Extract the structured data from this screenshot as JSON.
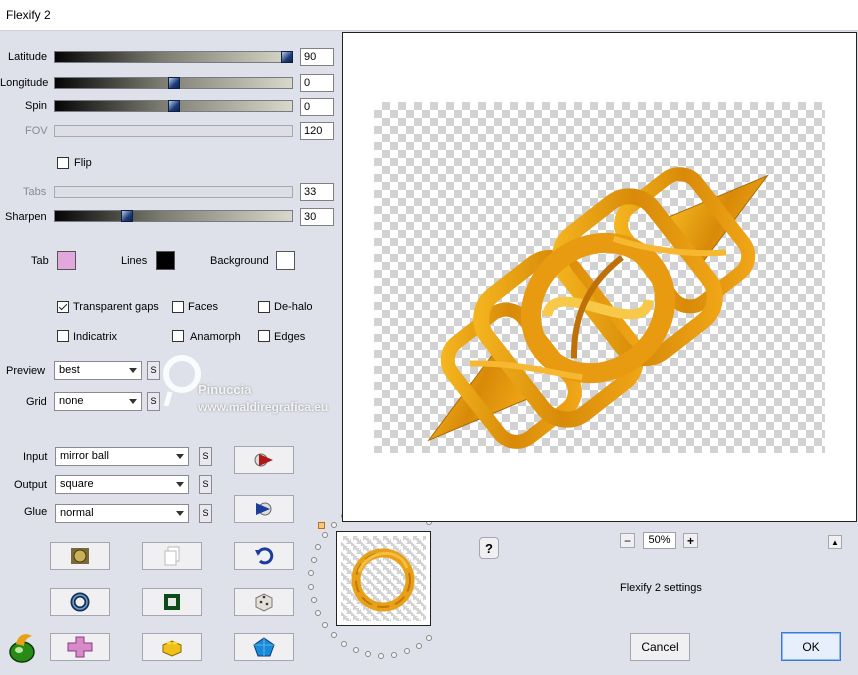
{
  "window": {
    "title": "Flexify 2"
  },
  "sliders": {
    "latitude": {
      "label": "Latitude",
      "value": "90",
      "fraction": 1.0
    },
    "longitude": {
      "label": "Longitude",
      "value": "0",
      "fraction": 0.5
    },
    "spin": {
      "label": "Spin",
      "value": "0",
      "fraction": 0.5
    },
    "fov": {
      "label": "FOV",
      "value": "120"
    },
    "tabs": {
      "label": "Tabs",
      "value": "33"
    },
    "sharpen": {
      "label": "Sharpen",
      "value": "30",
      "fraction": 0.3
    }
  },
  "flip": {
    "label": "Flip",
    "checked": false
  },
  "colors": {
    "tab": {
      "label": "Tab",
      "color": "#e0a8dc"
    },
    "lines": {
      "label": "Lines",
      "color": "#000000"
    },
    "background": {
      "label": "Background",
      "color": "#ffffff"
    }
  },
  "options": {
    "transparent_gaps": {
      "label": "Transparent gaps",
      "checked": true
    },
    "faces": {
      "label": "Faces",
      "checked": false
    },
    "de_halo": {
      "label": "De-halo",
      "checked": false
    },
    "indicatrix": {
      "label": "Indicatrix",
      "checked": false
    },
    "anamorph": {
      "label": "Anamorph",
      "checked": false
    },
    "edges": {
      "label": "Edges",
      "checked": false
    }
  },
  "selects": {
    "preview": {
      "label": "Preview",
      "value": "best"
    },
    "grid": {
      "label": "Grid",
      "value": "none"
    },
    "input": {
      "label": "Input",
      "value": "mirror ball"
    },
    "output": {
      "label": "Output",
      "value": "square"
    },
    "glue": {
      "label": "Glue",
      "value": "normal"
    },
    "s_label": "S"
  },
  "watermark": {
    "name": "Pinuccia",
    "url": "www.maldiregrafica.eu"
  },
  "zoom": {
    "value": "50%",
    "minus": "−",
    "plus": "+"
  },
  "help": "?",
  "collapse": "▲",
  "settings_label": "Flexify 2 settings",
  "buttons": {
    "cancel": "Cancel",
    "ok": "OK"
  },
  "accent": {
    "orange": "#e8a018",
    "navy": "#1d3c78"
  }
}
